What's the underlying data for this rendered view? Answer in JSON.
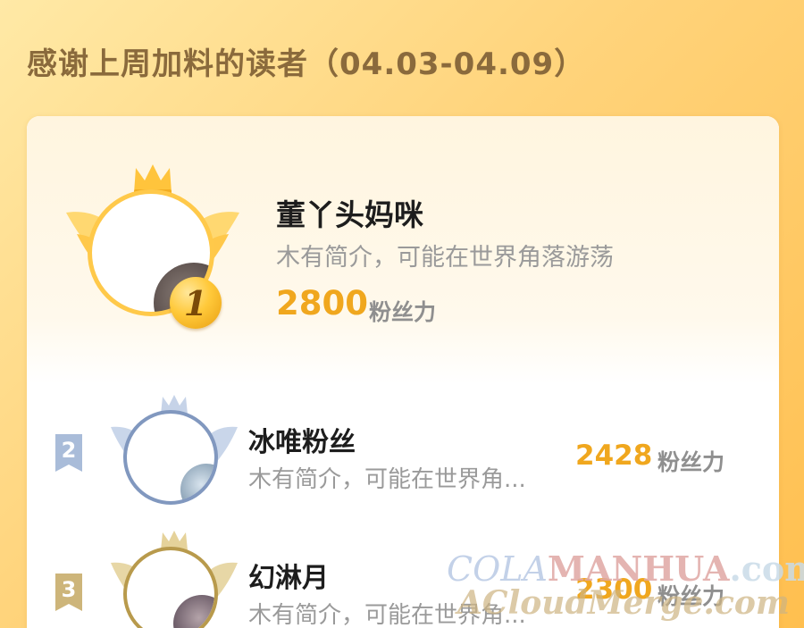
{
  "header": {
    "title": "感谢上周加料的读者（04.03-04.09）"
  },
  "ranking": [
    {
      "rank": "1",
      "name": "董丫头妈咪",
      "bio": "木有简介，可能在世界角落游荡",
      "score": "2800",
      "unit": "粉丝力"
    },
    {
      "rank": "2",
      "name": "冰唯粉丝",
      "bio": "木有简介，可能在世界角...",
      "score": "2428",
      "unit": "粉丝力"
    },
    {
      "rank": "3",
      "name": "幻淋月",
      "bio": "木有简介，可能在世界角...",
      "score": "2300",
      "unit": "粉丝力"
    }
  ],
  "watermark": {
    "line1_a": "COLA",
    "line1_b": "MANHUA",
    "line1_c": ".com",
    "line2": "ACloudMerge.com"
  },
  "colors": {
    "accent_score": "#f0a71e",
    "gold": "#ffc93a",
    "silver": "#9fb0cc",
    "bronze": "#c7ac6a"
  }
}
